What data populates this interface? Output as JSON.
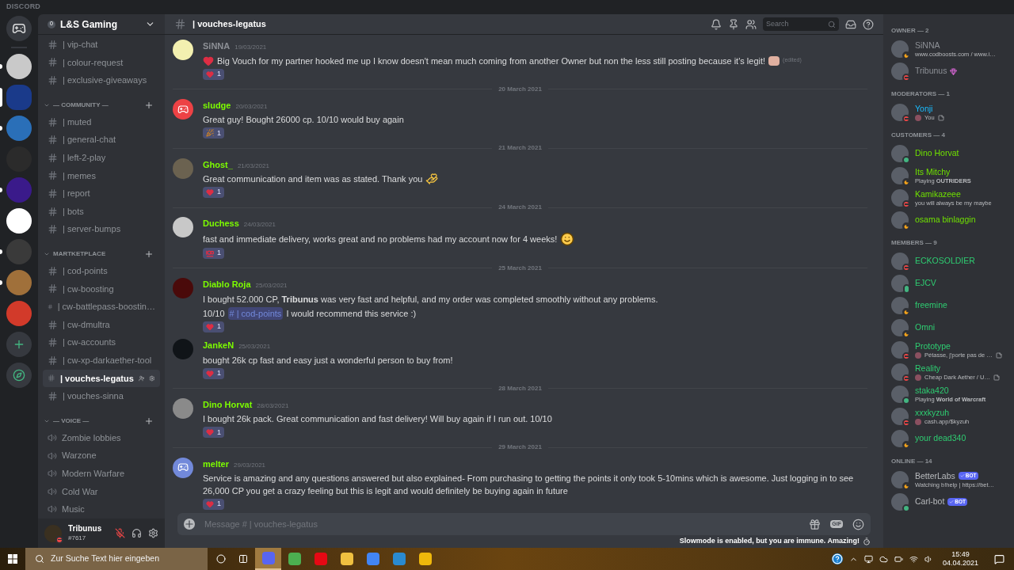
{
  "app_title": "DISCORD",
  "servers": [
    {
      "unread": true,
      "selected": false
    },
    {
      "selected": true
    },
    {
      "unread": true,
      "selected": false
    },
    {
      "unread": false,
      "selected": false
    },
    {
      "unread": true,
      "selected": false
    },
    {
      "unread": false,
      "selected": false
    },
    {
      "unread": true,
      "selected": false
    },
    {
      "unread": true,
      "selected": false
    },
    {
      "unread": false,
      "selected": false
    }
  ],
  "server": {
    "badge": "0",
    "name": "L&S Gaming"
  },
  "categories": [
    {
      "channels": [
        {
          "name": "| vip-chat",
          "kind": "text",
          "selected": false
        },
        {
          "name": "| colour-request",
          "kind": "text",
          "selected": false
        },
        {
          "name": "| exclusive-giveaways",
          "kind": "text",
          "selected": false
        }
      ]
    },
    {
      "name": "— COMMUNITY —",
      "channels": [
        {
          "name": "| muted",
          "kind": "text",
          "selected": false
        },
        {
          "name": "| general-chat",
          "kind": "text",
          "selected": false
        },
        {
          "name": "| left-2-play",
          "kind": "text",
          "selected": false
        },
        {
          "name": "| memes",
          "kind": "text",
          "selected": false
        },
        {
          "name": "| report",
          "kind": "text",
          "selected": false
        },
        {
          "name": "| bots",
          "kind": "text",
          "selected": false
        },
        {
          "name": "| server-bumps",
          "kind": "text",
          "selected": false
        }
      ]
    },
    {
      "name": "MARTKETPLACE",
      "channels": [
        {
          "name": "| cod-points",
          "kind": "text",
          "selected": false
        },
        {
          "name": "| cw-boosting",
          "kind": "text",
          "selected": false
        },
        {
          "name": "| cw-battlepass-boostin…",
          "kind": "text",
          "selected": false
        },
        {
          "name": "| cw-dmultra",
          "kind": "text",
          "selected": false
        },
        {
          "name": "| cw-accounts",
          "kind": "text",
          "selected": false
        },
        {
          "name": "| cw-xp-darkaether-tool",
          "kind": "text",
          "selected": false
        },
        {
          "name": "| vouches-legatus",
          "kind": "text",
          "selected": true
        },
        {
          "name": "| vouches-sinna",
          "kind": "text",
          "selected": false
        }
      ]
    },
    {
      "name": "— VOICE —",
      "channels": [
        {
          "name": "Zombie lobbies",
          "kind": "voice",
          "selected": false
        },
        {
          "name": "Warzone",
          "kind": "voice",
          "selected": false
        },
        {
          "name": "Modern Warfare",
          "kind": "voice",
          "selected": false
        },
        {
          "name": "Cold War",
          "kind": "voice",
          "selected": false
        },
        {
          "name": "Music",
          "kind": "voice",
          "selected": false
        }
      ]
    }
  ],
  "user": {
    "name": "Tribunus",
    "tag": "#7617",
    "presence": {
      "kind": "dnd"
    },
    "muted": true
  },
  "header": {
    "channel": "| vouches-legatus",
    "search_placeholder": "Search"
  },
  "messages": [
    {
      "kind": "message",
      "author": "SiNNA",
      "color": "#8d9096",
      "time": "19/03/2021",
      "avatar": {
        "kind": "photo",
        "color": "#f3f0b0"
      },
      "lines": [
        [
          {
            "kind": "heart_emoji"
          },
          {
            "kind": "text",
            "text": "Big Vouch for my partner hooked me up I know doesn't mean much coming from another Owner but non the less still posting because it's legit!"
          },
          {
            "kind": "image"
          },
          {
            "kind": "edited",
            "text": "(edited)"
          }
        ]
      ],
      "reaction": {
        "kind": "heart",
        "count": "1"
      }
    },
    {
      "kind": "divider",
      "date": "20 March 2021"
    },
    {
      "kind": "message",
      "author": "sludge",
      "color": "#7cfc00",
      "time": "20/03/2021",
      "avatar": {
        "kind": "logo",
        "color": "#ed4245"
      },
      "lines": [
        [
          {
            "kind": "text",
            "text": "Great guy! Bought 26000 cp. 10/10 would buy again"
          }
        ]
      ],
      "reaction": {
        "kind": "party",
        "count": "1"
      }
    },
    {
      "kind": "divider",
      "date": "21 March 2021"
    },
    {
      "kind": "message",
      "author": "Ghost_",
      "color": "#7cfc00",
      "time": "21/03/2021",
      "avatar": {
        "kind": "photo",
        "color": "#6b6250"
      },
      "lines": [
        [
          {
            "kind": "text",
            "text": "Great communication and item was as stated. Thank you"
          },
          {
            "kind": "pray_emoji"
          }
        ]
      ],
      "reaction": {
        "kind": "heart",
        "count": "1"
      }
    },
    {
      "kind": "divider",
      "date": "24 March 2021"
    },
    {
      "kind": "message",
      "author": "Duchess",
      "color": "#7cfc00",
      "time": "24/03/2021",
      "avatar": {
        "kind": "photo",
        "color": "#c8c8c8"
      },
      "lines": [
        [
          {
            "kind": "text",
            "text": "fast and immediate delivery, works great and no problems had my account now for 4 weeks!"
          },
          {
            "kind": "smile_emoji"
          }
        ]
      ],
      "reaction": {
        "kind": "hundred",
        "count": "1"
      }
    },
    {
      "kind": "divider",
      "date": "25 March 2021"
    },
    {
      "kind": "message",
      "author": "Diablo Roja",
      "color": "#7cfc00",
      "time": "25/03/2021",
      "avatar": {
        "kind": "photo",
        "color": "#4a0a0a"
      },
      "lines": [
        [
          {
            "kind": "text",
            "text": "I bought 52.000 CP, **Tribunus** was very fast and helpful, and my order was completed smoothly without any problems."
          }
        ],
        [
          {
            "kind": "text",
            "text": "10/10"
          },
          {
            "kind": "mention",
            "text": "# | cod-points"
          },
          {
            "kind": "text",
            "text": "I would recommend this service :)"
          }
        ]
      ],
      "reaction": {
        "kind": "heart",
        "count": "1"
      }
    },
    {
      "kind": "message",
      "author": "JankeN",
      "color": "#7cfc00",
      "time": "25/03/2021",
      "avatar": {
        "kind": "photo",
        "color": "#101418"
      },
      "lines": [
        [
          {
            "kind": "text",
            "text": "bought 26k cp fast and easy just a wonderful person to buy from!"
          }
        ]
      ],
      "reaction": {
        "kind": "heart",
        "count": "1"
      }
    },
    {
      "kind": "divider",
      "date": "28 March 2021"
    },
    {
      "kind": "message",
      "author": "Dino Horvat",
      "color": "#7cfc00",
      "time": "28/03/2021",
      "avatar": {
        "kind": "photo",
        "color": "#8a8a8a"
      },
      "lines": [
        [
          {
            "kind": "text",
            "text": "I bought 26k pack. Great communication and fast delivery! Will buy again if I run out. 10/10"
          }
        ]
      ],
      "reaction": {
        "kind": "heart",
        "count": "1"
      }
    },
    {
      "kind": "divider",
      "date": "29 March 2021"
    },
    {
      "kind": "message",
      "author": "melter",
      "color": "#7cfc00",
      "time": "29/03/2021",
      "avatar": {
        "kind": "logo",
        "color": "#7289da"
      },
      "lines": [
        [
          {
            "kind": "text",
            "text": "Service is amazing and any questions answered but also explained- From purchasing to getting the points it only took 5-10mins which is awesome. Just logging in to see 26,000 CP you get a crazy feeling but this is legit and would definitely be buying again in future"
          }
        ]
      ],
      "reaction": {
        "kind": "heart",
        "count": "1"
      }
    }
  ],
  "composer": {
    "placeholder": "Message # | vouches-legatus",
    "gif_label": "GIF",
    "notice": "Slowmode is enabled, but you are immune. Amazing!"
  },
  "member_groups": [
    {
      "title": "OWNER — 2",
      "color": "#8d9096",
      "members": [
        {
          "name": "SiNNA",
          "presence": {
            "kind": "idle"
          },
          "activity": "www.codboosts.com / www.i…"
        },
        {
          "name": "Tribunus",
          "presence": {
            "kind": "dnd"
          },
          "boost": true
        }
      ]
    },
    {
      "title": "MODERATORS — 1",
      "color": "#1abcff",
      "members": [
        {
          "name": "Yonji",
          "presence": {
            "kind": "dnd"
          },
          "activity": "You",
          "activity_image": true,
          "note": true
        }
      ]
    },
    {
      "title": "CUSTOMERS — 4",
      "color": "#6fe000",
      "members": [
        {
          "name": "Dino Horvat",
          "presence": {
            "kind": "online"
          }
        },
        {
          "name": "Its Mitchy",
          "presence": {
            "kind": "idle"
          },
          "activity": "Playing **OUTRIDERS**"
        },
        {
          "name": "Kamikazeee",
          "presence": {
            "kind": "dnd"
          },
          "activity": "you will always be my maybe"
        },
        {
          "name": "osama binlaggin",
          "presence": {
            "kind": "idle"
          }
        }
      ]
    },
    {
      "title": "MEMBERS — 9",
      "color": "#2ecc71",
      "members": [
        {
          "name": "ECKOSOLDIER",
          "presence": {
            "kind": "dnd"
          }
        },
        {
          "name": "EJCV",
          "presence": {
            "kind": "mobile"
          }
        },
        {
          "name": "freemine",
          "presence": {
            "kind": "idle"
          }
        },
        {
          "name": "Omni",
          "presence": {
            "kind": "idle"
          }
        },
        {
          "name": "Prototype",
          "presence": {
            "kind": "dnd"
          },
          "activity": "Pétasse, j'porte pas de …",
          "activity_image": true,
          "note": true
        },
        {
          "name": "Reality",
          "presence": {
            "kind": "dnd"
          },
          "activity": "Cheap Dark Aether / U…",
          "activity_image": true,
          "note": true
        },
        {
          "name": "staka420",
          "presence": {
            "kind": "online"
          },
          "activity": "Playing **World of Warcraft**"
        },
        {
          "name": "xxxkyzuh",
          "presence": {
            "kind": "dnd"
          },
          "activity": "cash.app/$kyzuh",
          "activity_image": true
        },
        {
          "name": "your dead340",
          "presence": {
            "kind": "idle"
          }
        }
      ]
    },
    {
      "title": "ONLINE — 14",
      "color": "#b9bbbe",
      "members": [
        {
          "name": "BetterLabs",
          "presence": {
            "kind": "idle"
          },
          "badge": "BOT",
          "activity": "Watching b!help | https://bet…"
        },
        {
          "name": "Carl-bot",
          "presence": {
            "kind": "online"
          },
          "badge": "BOT"
        }
      ]
    }
  ],
  "taskbar": {
    "search_placeholder": "Zur Suche Text hier eingeben",
    "apps": [
      {
        "selected": true
      },
      {
        "selected": false
      },
      {
        "selected": false
      },
      {
        "selected": false
      },
      {
        "selected": false
      },
      {
        "selected": false
      },
      {
        "selected": false
      }
    ],
    "time": "15:49",
    "date": "04.04.2021"
  }
}
